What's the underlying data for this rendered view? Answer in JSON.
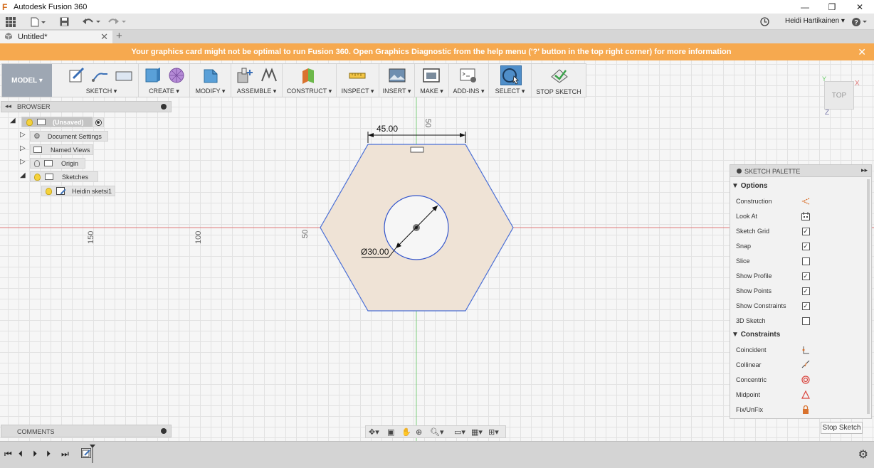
{
  "window": {
    "title": "Autodesk Fusion 360",
    "controls": [
      "—",
      "❐",
      "✕"
    ]
  },
  "qat": {
    "user": "Heidi Hartikainen ▾",
    "help": "?"
  },
  "tab": {
    "label": "Untitled*"
  },
  "banner": {
    "message": "Your graphics card might not be optimal to run Fusion 360. Open Graphics Diagnostic from the help menu ('?' button in the top right corner) for more information",
    "close": "✕"
  },
  "ribbon": {
    "workspace": "MODEL ▾",
    "groups": [
      "SKETCH ▾",
      "CREATE ▾",
      "MODIFY ▾",
      "ASSEMBLE ▾",
      "CONSTRUCT ▾",
      "INSPECT ▾",
      "INSERT ▾",
      "MAKE ▾",
      "ADD-INS ▾",
      "SELECT ▾",
      "STOP SKETCH"
    ]
  },
  "browser": {
    "title": "BROWSER",
    "root": "(Unsaved)",
    "items": [
      "Document Settings",
      "Named Views",
      "Origin",
      "Sketches"
    ],
    "sketch": "Heidin sketsi1"
  },
  "comments": {
    "title": "COMMENTS"
  },
  "viewcube": {
    "face": "TOP",
    "axis_x": "X",
    "axis_y": "Y",
    "axis_z": "Z"
  },
  "canvas": {
    "dim_width": "45.00",
    "dim_diameter": "Ø30.00",
    "ruler_left_150": "150",
    "ruler_left_100": "100",
    "ruler_left_50": "50",
    "ruler_top_50": "50"
  },
  "palette": {
    "title": "SKETCH PALETTE",
    "options_title": "Options",
    "options": [
      {
        "label": "Construction",
        "type": "icon",
        "icon": "construction-icon"
      },
      {
        "label": "Look At",
        "type": "icon",
        "icon": "look-at-icon"
      },
      {
        "label": "Sketch Grid",
        "type": "check",
        "checked": true
      },
      {
        "label": "Snap",
        "type": "check",
        "checked": true
      },
      {
        "label": "Slice",
        "type": "check",
        "checked": false
      },
      {
        "label": "Show Profile",
        "type": "check",
        "checked": true
      },
      {
        "label": "Show Points",
        "type": "check",
        "checked": true
      },
      {
        "label": "Show Constraints",
        "type": "check",
        "checked": true
      },
      {
        "label": "3D Sketch",
        "type": "check",
        "checked": false
      }
    ],
    "constraints_title": "Constraints",
    "constraints": [
      {
        "label": "Coincident",
        "icon": "coincident-icon"
      },
      {
        "label": "Collinear",
        "icon": "collinear-icon"
      },
      {
        "label": "Concentric",
        "icon": "concentric-icon"
      },
      {
        "label": "Midpoint",
        "icon": "midpoint-icon"
      },
      {
        "label": "Fix/UnFix",
        "icon": "lock-icon"
      }
    ],
    "stop_button": "Stop Sketch"
  }
}
